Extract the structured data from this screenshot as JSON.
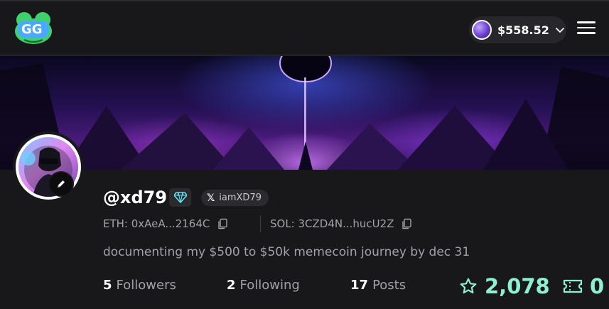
{
  "header": {
    "logo_icon": "gg-frog-logo-icon",
    "wallet": {
      "balance": "$558.52",
      "avatar_icon": "wallet-avatar-icon",
      "chevron_icon": "chevron-down-icon"
    },
    "menu_icon": "hamburger-menu-icon"
  },
  "banner": {
    "description_icon": "profile-banner-image"
  },
  "profile": {
    "avatar_icon": "profile-avatar-image",
    "edit_icon": "pencil-icon",
    "username": "@xd79",
    "badge_icon": "diamond-icon",
    "x_handle": "iamXD79",
    "x_icon": "x-logo-icon",
    "eth_address": "ETH: 0xAeA...2164C",
    "sol_address": "SOL: 3CZD4N...hucU2Z",
    "copy_icon": "copy-icon",
    "bio": "documenting my $500 to $50k memecoin journey by dec 31"
  },
  "stats": {
    "followers_count": "5",
    "followers_label": "Followers",
    "following_count": "2",
    "following_label": "Following",
    "posts_count": "17",
    "posts_label": "Posts"
  },
  "rewards": {
    "points": "2,078",
    "points_icon": "star-icon",
    "tickets": "0",
    "tickets_icon": "ticket-icon"
  },
  "colors": {
    "accent": "#8ff0cf",
    "background": "#18181b",
    "muted_text": "#a1a1a8"
  }
}
